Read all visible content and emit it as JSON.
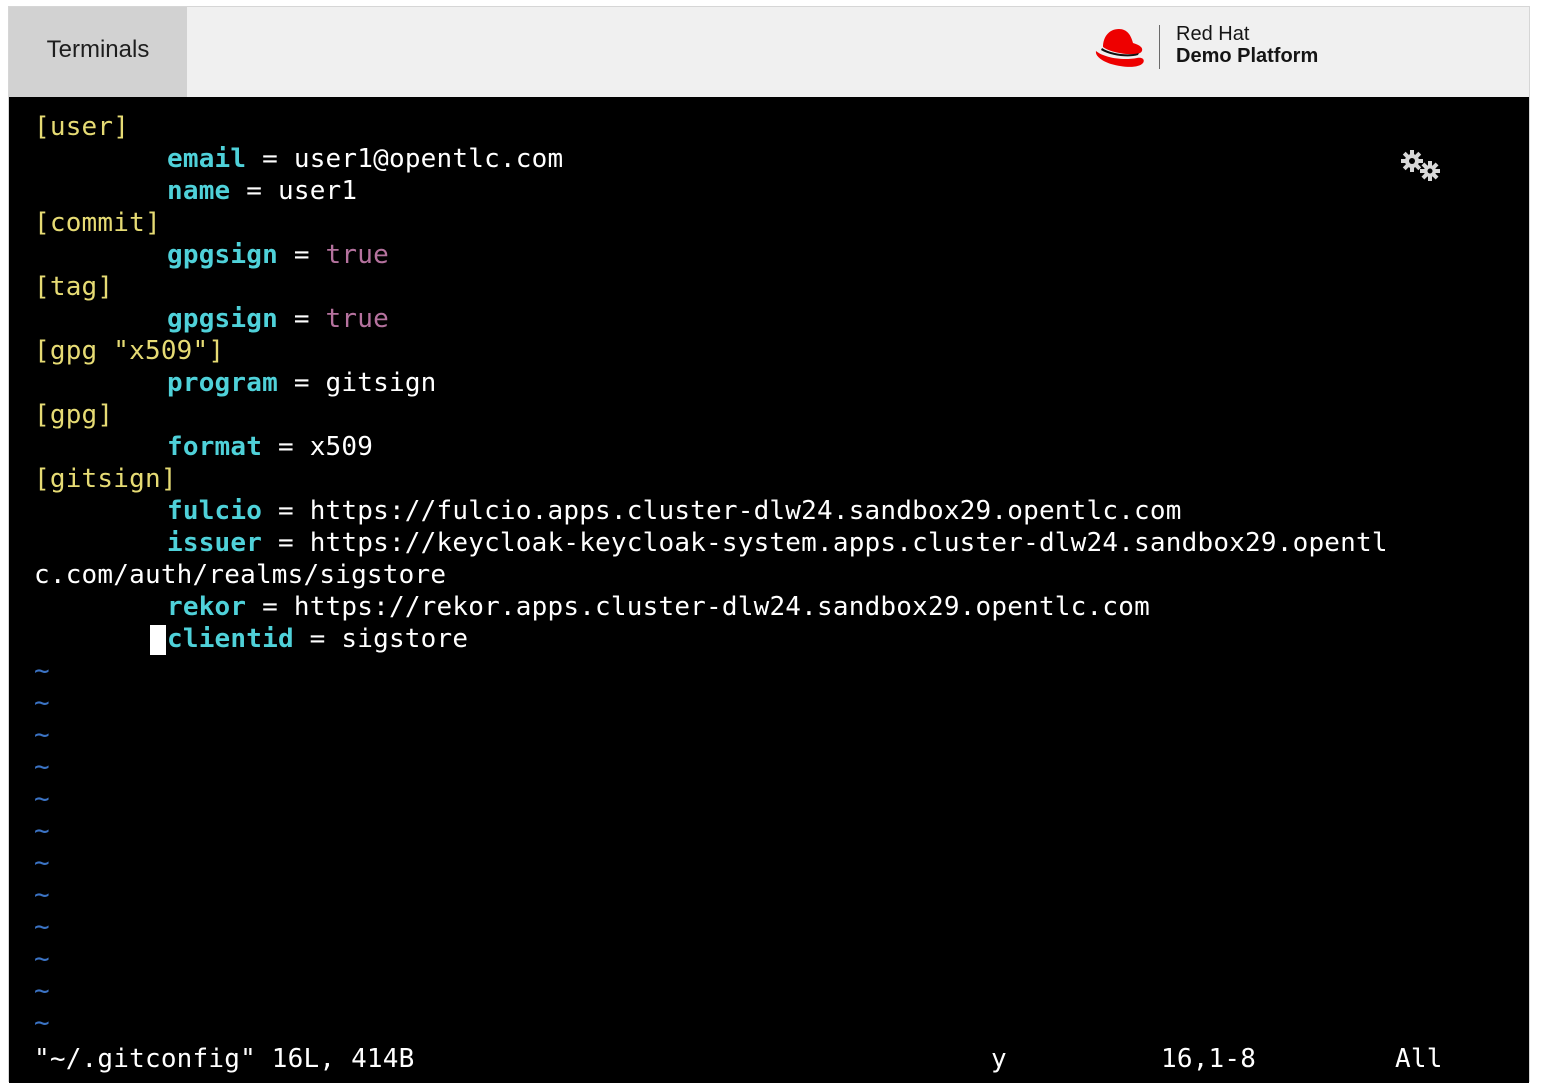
{
  "header": {
    "tab_label": "Terminals",
    "brand_line1": "Red Hat",
    "brand_line2": "Demo Platform"
  },
  "terminal": {
    "lines": [
      {
        "section": "[user]"
      },
      {
        "key": "email",
        "value": "user1@opentlc.com"
      },
      {
        "key": "name",
        "value": "user1"
      },
      {
        "section": "[commit]"
      },
      {
        "key": "gpgsign",
        "value": "true"
      },
      {
        "section": "[tag]"
      },
      {
        "key": "gpgsign",
        "value": "true"
      },
      {
        "section": "[gpg \"x509\"]"
      },
      {
        "key": "program",
        "value": "gitsign"
      },
      {
        "section": "[gpg]"
      },
      {
        "key": "format",
        "value": "x509"
      },
      {
        "section": "[gitsign]"
      },
      {
        "key": "fulcio",
        "value": "https://fulcio.apps.cluster-dlw24.sandbox29.opentlc.com"
      },
      {
        "key": "issuer",
        "value": "https://keycloak-keycloak-system.apps.cluster-dlw24.sandbox29.opentl"
      },
      {
        "wrap": "c.com/auth/realms/sigstore"
      },
      {
        "key": "rekor",
        "value": "https://rekor.apps.cluster-dlw24.sandbox29.opentlc.com"
      },
      {
        "key": "clientid",
        "value": "sigstore"
      }
    ],
    "tilde": "~",
    "tilde_count": 12,
    "equals": "=",
    "status": {
      "file": "\"~/.gitconfig\" 16L, 414B",
      "mode": "y",
      "position": "16,1-8",
      "scroll": "All"
    }
  },
  "icons": [
    "redhat-hat-icon",
    "settings-gears-icon"
  ],
  "colors": {
    "section": "#e6db74",
    "key": "#4fd1d9",
    "boolean": "#b5729e",
    "tilde": "#3b73c4",
    "background": "#000000"
  }
}
